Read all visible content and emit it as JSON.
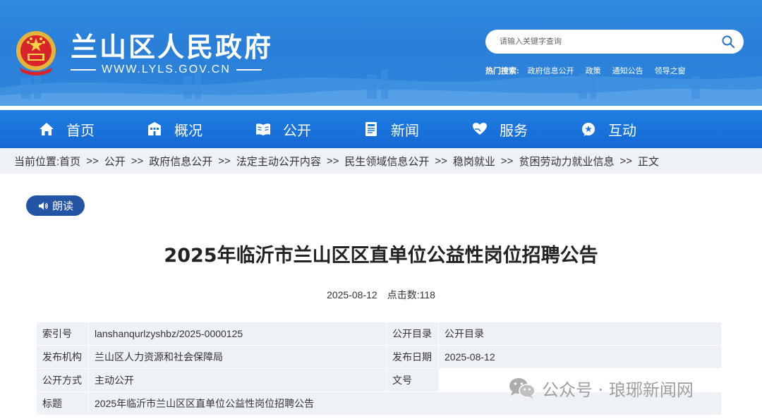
{
  "header": {
    "site_name": "兰山区人民政府",
    "site_url": "WWW.LYLS.GOV.CN",
    "search": {
      "placeholder": "请输入关键字查询"
    },
    "hot_search": {
      "title": "热门搜索:",
      "links": [
        "政府信息公开",
        "政策",
        "通知公告",
        "领导之窗"
      ]
    }
  },
  "nav": {
    "items": [
      {
        "label": "首页",
        "icon": "home-icon"
      },
      {
        "label": "概况",
        "icon": "building-icon"
      },
      {
        "label": "公开",
        "icon": "book-icon"
      },
      {
        "label": "新闻",
        "icon": "news-icon"
      },
      {
        "label": "服务",
        "icon": "heart-hand-icon"
      },
      {
        "label": "互动",
        "icon": "chat-icon"
      }
    ]
  },
  "breadcrumb": {
    "prefix": "当前位置:",
    "items": [
      "首页",
      "公开",
      "政府信息公开",
      "法定主动公开内容",
      "民生领域信息公开",
      "稳岗就业",
      "贫困劳动力就业信息",
      "正文"
    ],
    "separator": ">>"
  },
  "read_button": {
    "label": "朗读"
  },
  "article": {
    "title": "2025年临沂市兰山区区直单位公益性岗位招聘公告",
    "date": "2025-08-12",
    "clicks_label": "点击数:",
    "clicks": "118"
  },
  "info_table": {
    "rows": [
      {
        "k1": "索引号",
        "v1": "lanshanqurlzyshbz/2025-0000125",
        "k2": "公开目录",
        "v2": "公开目录"
      },
      {
        "k1": "发布机构",
        "v1": "兰山区人力资源和社会保障局",
        "k2": "发布日期",
        "v2": "2025-08-12"
      },
      {
        "k1": "公开方式",
        "v1": "主动公开",
        "k2": "文号",
        "v2": ""
      },
      {
        "k1": "标题",
        "v1": "2025年临沂市兰山区区直单位公益性岗位招聘公告"
      }
    ]
  },
  "watermark": {
    "text": "公众号 · 琅琊新闻网"
  },
  "colors": {
    "banner_blue": "#2a7fd8",
    "nav_blue": "#1568d4",
    "read_button": "#2455a4",
    "breadcrumb_bg": "#eef2f7"
  }
}
